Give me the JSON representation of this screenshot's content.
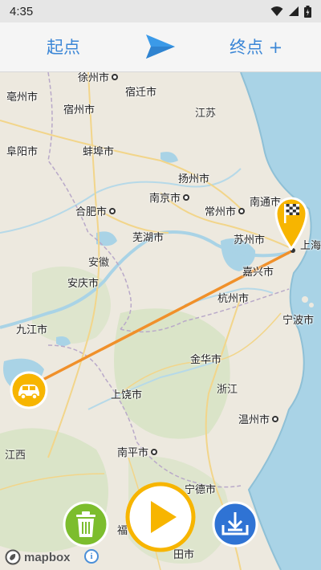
{
  "status_bar": {
    "time": "4:35"
  },
  "route_header": {
    "start_label": "起点",
    "end_label": "终点 +"
  },
  "map": {
    "cities": [
      {
        "name": "徐州市",
        "id": "xuzhou"
      },
      {
        "name": "亳州市",
        "id": "bozhou"
      },
      {
        "name": "宿迁市",
        "id": "suqian"
      },
      {
        "name": "宿州市",
        "id": "suzhou-ah"
      },
      {
        "name": "阜阳市",
        "id": "fuyang"
      },
      {
        "name": "蚌埠市",
        "id": "bengbu"
      },
      {
        "name": "扬州市",
        "id": "yangzhou"
      },
      {
        "name": "南京市",
        "id": "nanjing"
      },
      {
        "name": "合肥市",
        "id": "hefei"
      },
      {
        "name": "常州市",
        "id": "changzhou"
      },
      {
        "name": "南通市",
        "id": "nantong"
      },
      {
        "name": "芜湖市",
        "id": "wuhu"
      },
      {
        "name": "苏州市",
        "id": "suzhou-js"
      },
      {
        "name": "上海",
        "id": "shanghai"
      },
      {
        "name": "嘉兴市",
        "id": "jiaxing"
      },
      {
        "name": "安庆市",
        "id": "anqing"
      },
      {
        "name": "杭州市",
        "id": "hangzhou"
      },
      {
        "name": "宁波市",
        "id": "ningbo"
      },
      {
        "name": "九江市",
        "id": "jiujiang"
      },
      {
        "name": "金华市",
        "id": "jinhua"
      },
      {
        "name": "上饶市",
        "id": "shangrao"
      },
      {
        "name": "温州市",
        "id": "wenzhou"
      },
      {
        "name": "南平市",
        "id": "nanping"
      },
      {
        "name": "宁德市",
        "id": "ningde"
      },
      {
        "name": "福",
        "id": "fuzhou-partial"
      },
      {
        "name": "田市",
        "id": "putian-partial"
      }
    ],
    "provinces": [
      {
        "name": "江苏",
        "id": "jiangsu"
      },
      {
        "name": "安徽",
        "id": "anhui"
      },
      {
        "name": "浙江",
        "id": "zhejiang"
      },
      {
        "name": "江西",
        "id": "jiangxi"
      }
    ],
    "attribution": {
      "logo_text": "mapbox",
      "info": "i"
    }
  },
  "colors": {
    "accent_blue": "#3b86d6",
    "route_line": "#f0902a",
    "marker_yellow": "#f7b500",
    "trash_green": "#7cbd2d",
    "download_blue": "#2f73d4"
  },
  "icons": {
    "send": "send-icon",
    "car": "car-icon",
    "flag": "finish-flag-icon",
    "trash": "trash-icon",
    "play": "play-icon",
    "download": "download-icon"
  }
}
